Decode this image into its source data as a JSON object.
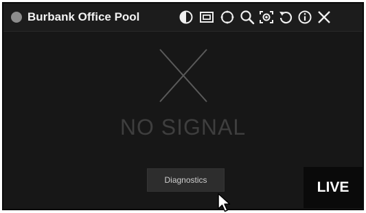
{
  "camera": {
    "title": "Burbank Office Pool",
    "status_color": "#8c8c8c"
  },
  "toolbar": {
    "icons": [
      "contrast-icon",
      "picture-in-picture-icon",
      "ptz-icon",
      "search-icon",
      "snapshot-icon",
      "refresh-icon",
      "info-icon",
      "close-icon"
    ]
  },
  "video": {
    "message": "NO SIGNAL",
    "diagnostics_label": "Diagnostics",
    "live_badge": "LIVE"
  }
}
